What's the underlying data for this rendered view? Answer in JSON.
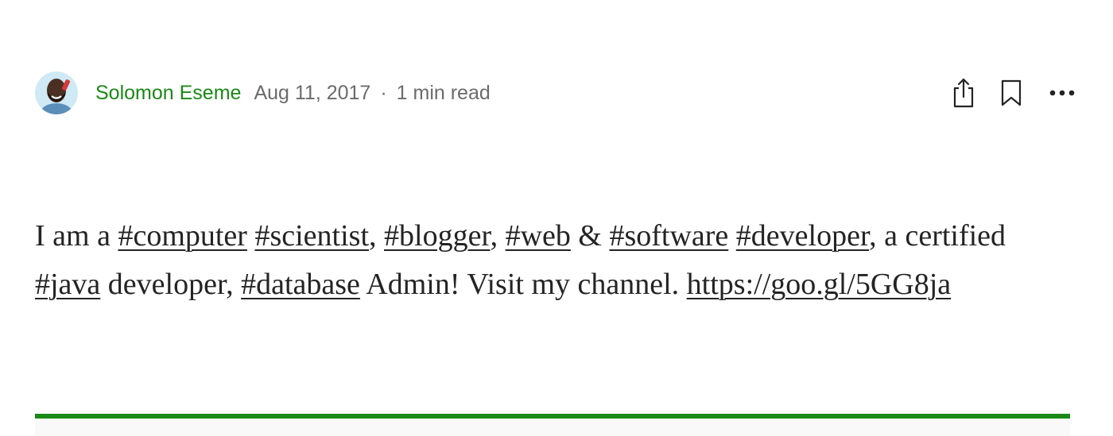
{
  "author": {
    "name": "Solomon Eseme",
    "avatar_icon": "author-avatar"
  },
  "post_meta": {
    "date": "Aug 11, 2017",
    "separator": "·",
    "read_time": "1 min read"
  },
  "actions": {
    "share_icon": "share-icon",
    "bookmark_icon": "bookmark-icon",
    "more_icon": "more-options-icon"
  },
  "body": {
    "t1": "I am a ",
    "tag_computer": "#computer",
    "t2": " ",
    "tag_scientist": "#scientist",
    "t3": ", ",
    "tag_blogger": "#blogger",
    "t4": ", ",
    "tag_web": "#web",
    "t5": " & ",
    "tag_software": "#software",
    "t6": " ",
    "tag_developer": "#developer",
    "t7": ", a certified ",
    "tag_java": "#java",
    "t8": " developer, ",
    "tag_database": "#database",
    "t9": " Admin! Visit my channel. ",
    "link": "https://goo.gl/5GG8ja"
  },
  "colors": {
    "accent_green": "#1a8917",
    "text": "#242424",
    "muted": "#6b6b6b"
  }
}
